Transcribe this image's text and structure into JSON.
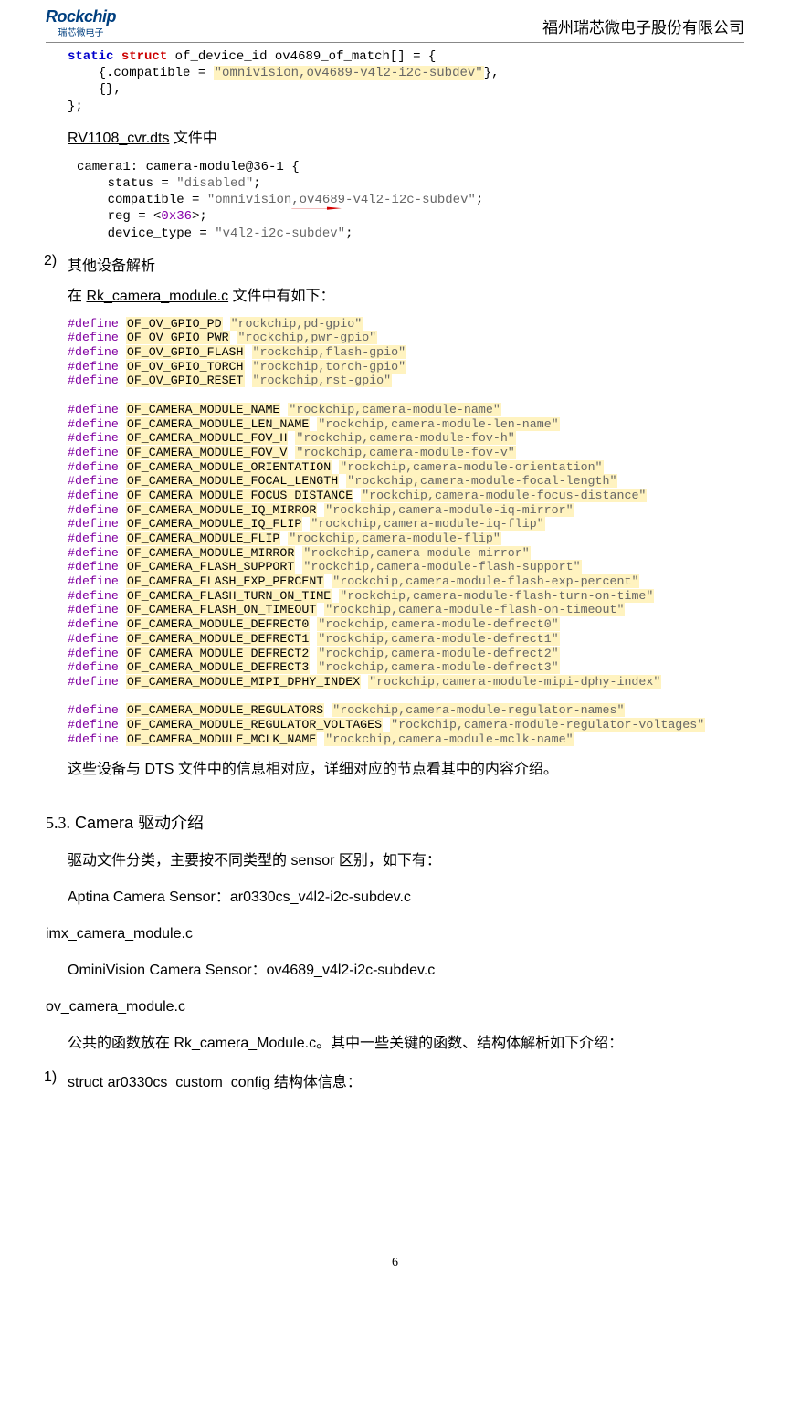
{
  "header": {
    "logo_main": "Rockchip",
    "logo_sub": "瑞芯微电子",
    "company": "福州瑞芯微电子股份有限公司"
  },
  "code1": {
    "l1a": "static",
    "l1b": "struct",
    "l1c": " of_device_id ov4689_of_match[] = {",
    "l2a": "    {.compatible = ",
    "l2b": "\"omnivision,ov4689-v4l2-i2c-subdev\"",
    "l2c": "},",
    "l3": "    {},",
    "l4": "};"
  },
  "text1_a": "RV1108_cvr.dts",
  "text1_b": " 文件中",
  "code2": {
    "l1": "camera1: camera-module@36-1 {",
    "l2a": "    status = ",
    "l2b": "\"disabled\"",
    "l2c": ";",
    "l3a": "    compatible = ",
    "l3b": "\"omnivision,ov4689-v4l2-i2c-subdev\"",
    "l3c": ";",
    "l4a": "    reg = <",
    "l4b": "0x36",
    "l4c": ">;",
    "l5a": "    device_type = ",
    "l5b": "\"v4l2-i2c-subdev\"",
    "l5c": ";"
  },
  "item2": {
    "n": "2)",
    "label": "其他设备解析"
  },
  "text2_a": "在 ",
  "text2_link": "Rk_camera_module.c",
  "text2_b": " 文件中有如下：",
  "defines": [
    {
      "d": "#define",
      "m": "OF_OV_GPIO_PD",
      "v": "\"rockchip,pd-gpio\""
    },
    {
      "d": "#define",
      "m": "OF_OV_GPIO_PWR",
      "v": "\"rockchip,pwr-gpio\""
    },
    {
      "d": "#define",
      "m": "OF_OV_GPIO_FLASH",
      "v": "\"rockchip,flash-gpio\""
    },
    {
      "d": "#define",
      "m": "OF_OV_GPIO_TORCH",
      "v": "\"rockchip,torch-gpio\""
    },
    {
      "d": "#define",
      "m": "OF_OV_GPIO_RESET",
      "v": "\"rockchip,rst-gpio\""
    },
    {
      "gap": true
    },
    {
      "d": "#define",
      "m": "OF_CAMERA_MODULE_NAME",
      "v": "\"rockchip,camera-module-name\""
    },
    {
      "d": "#define",
      "m": "OF_CAMERA_MODULE_LEN_NAME",
      "v": "\"rockchip,camera-module-len-name\""
    },
    {
      "d": "#define",
      "m": "OF_CAMERA_MODULE_FOV_H",
      "v": "\"rockchip,camera-module-fov-h\""
    },
    {
      "d": "#define",
      "m": "OF_CAMERA_MODULE_FOV_V",
      "v": "\"rockchip,camera-module-fov-v\""
    },
    {
      "d": "#define",
      "m": "OF_CAMERA_MODULE_ORIENTATION",
      "v": "\"rockchip,camera-module-orientation\""
    },
    {
      "d": "#define",
      "m": "OF_CAMERA_MODULE_FOCAL_LENGTH",
      "v": "\"rockchip,camera-module-focal-length\""
    },
    {
      "d": "#define",
      "m": "OF_CAMERA_MODULE_FOCUS_DISTANCE",
      "v": "\"rockchip,camera-module-focus-distance\""
    },
    {
      "d": "#define",
      "m": "OF_CAMERA_MODULE_IQ_MIRROR",
      "v": "\"rockchip,camera-module-iq-mirror\""
    },
    {
      "d": "#define",
      "m": "OF_CAMERA_MODULE_IQ_FLIP",
      "v": "\"rockchip,camera-module-iq-flip\""
    },
    {
      "d": "#define",
      "m": "OF_CAMERA_MODULE_FLIP",
      "v": "\"rockchip,camera-module-flip\""
    },
    {
      "d": "#define",
      "m": "OF_CAMERA_MODULE_MIRROR",
      "v": "\"rockchip,camera-module-mirror\""
    },
    {
      "d": "#define",
      "m": "OF_CAMERA_FLASH_SUPPORT",
      "v": "\"rockchip,camera-module-flash-support\""
    },
    {
      "d": "#define",
      "m": "OF_CAMERA_FLASH_EXP_PERCENT",
      "v": "\"rockchip,camera-module-flash-exp-percent\""
    },
    {
      "d": "#define",
      "m": "OF_CAMERA_FLASH_TURN_ON_TIME",
      "v": "\"rockchip,camera-module-flash-turn-on-time\""
    },
    {
      "d": "#define",
      "m": "OF_CAMERA_FLASH_ON_TIMEOUT",
      "v": "\"rockchip,camera-module-flash-on-timeout\""
    },
    {
      "d": "#define",
      "m": "OF_CAMERA_MODULE_DEFRECT0",
      "v": "\"rockchip,camera-module-defrect0\""
    },
    {
      "d": "#define",
      "m": "OF_CAMERA_MODULE_DEFRECT1",
      "v": "\"rockchip,camera-module-defrect1\""
    },
    {
      "d": "#define",
      "m": "OF_CAMERA_MODULE_DEFRECT2",
      "v": "\"rockchip,camera-module-defrect2\""
    },
    {
      "d": "#define",
      "m": "OF_CAMERA_MODULE_DEFRECT3",
      "v": "\"rockchip,camera-module-defrect3\""
    },
    {
      "d": "#define",
      "m": "OF_CAMERA_MODULE_MIPI_DPHY_INDEX",
      "v": "\"rockchip,camera-module-mipi-dphy-index\""
    },
    {
      "gap": true
    },
    {
      "d": "#define",
      "m": "OF_CAMERA_MODULE_REGULATORS",
      "v": "\"rockchip,camera-module-regulator-names\""
    },
    {
      "d": "#define",
      "m": "OF_CAMERA_MODULE_REGULATOR_VOLTAGES",
      "v": "\"rockchip,camera-module-regulator-voltages\""
    },
    {
      "d": "#define",
      "m": "OF_CAMERA_MODULE_MCLK_NAME",
      "v": "\"rockchip,camera-module-mclk-name\""
    }
  ],
  "text3": "这些设备与 DTS 文件中的信息相对应，详细对应的节点看其中的内容介绍。",
  "section": {
    "num": "5.3.",
    "title": "Camera 驱动介绍"
  },
  "para1": "驱动文件分类，主要按不同类型的 sensor 区别，如下有：",
  "para_aptina": "Aptina Camera Sensor：ar0330cs_v4l2-i2c-subdev.c",
  "para_imx": "imx_camera_module.c",
  "para_omni": "OminiVision Camera Sensor：ov4689_v4l2-i2c-subdev.c",
  "para_ov": "ov_camera_module.c",
  "para_pub": "公共的函数放在 Rk_camera_Module.c。其中一些关键的函数、结构体解析如下介绍：",
  "item1b": {
    "n": "1)",
    "label": "struct ar0330cs_custom_config 结构体信息："
  },
  "page_number": "6"
}
